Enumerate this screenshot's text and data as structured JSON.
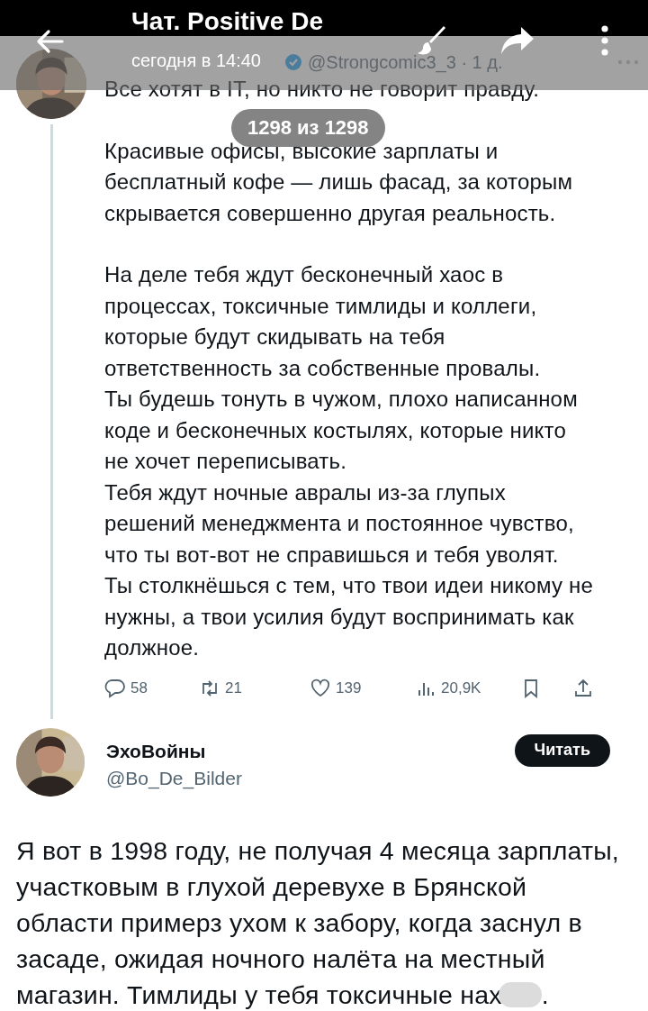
{
  "viewer": {
    "title": "Чат. Positive De",
    "subtitle": "сегодня в 14:40",
    "counter": "1298 из 1298"
  },
  "tweet": {
    "verified": true,
    "handle": "@Strongcomic3_3 · 1 д.",
    "paragraphs": [
      [
        "Все хотят в IT, но никто не говорит правду."
      ],
      [
        "Красивые офисы, высокие зарплаты и",
        "бесплатный кофе — лишь фасад, за которым",
        "скрывается совершенно другая реальность."
      ],
      [
        "На деле тебя ждут бесконечный хаос в",
        "процессах, токсичные тимлиды и коллеги,",
        "которые будут скидывать на тебя",
        "ответственность за собственные провалы.",
        "Ты будешь тонуть в чужом, плохо написанном",
        "коде и бесконечных костылях, которые никто",
        "не хочет переписывать.",
        "Тебя ждут ночные авралы из-за глупых",
        "решений менеджмента и постоянное чувство,",
        "что ты вот-вот не справишься и тебя уволят.",
        "Ты столкнёшься с тем, что твои идеи никому не",
        "нужны, а твои усилия будут воспринимать как",
        "должное."
      ]
    ],
    "actions": [
      {
        "kind": "reply",
        "count": "58"
      },
      {
        "kind": "repost",
        "count": "21"
      },
      {
        "kind": "like",
        "count": "139"
      },
      {
        "kind": "views",
        "count": "20,9K"
      },
      {
        "kind": "bookmark"
      },
      {
        "kind": "share"
      }
    ]
  },
  "reply": {
    "author": "ЭхоВойны",
    "handle": "@Bo_De_Bilder",
    "follow_button": "Читать",
    "lines": [
      "Я вот в 1998 году, не получая 4 месяца зарплаты,",
      "участковым в глухой деревухе в Брянской",
      "области примерз ухом к забору, когда заснул в",
      "засаде, ожидая ночного налёта на местный"
    ],
    "last_line": {
      "text": "магазин. Тимлиды у тебя токсичные нах",
      "censored": true,
      "end": "."
    }
  }
}
